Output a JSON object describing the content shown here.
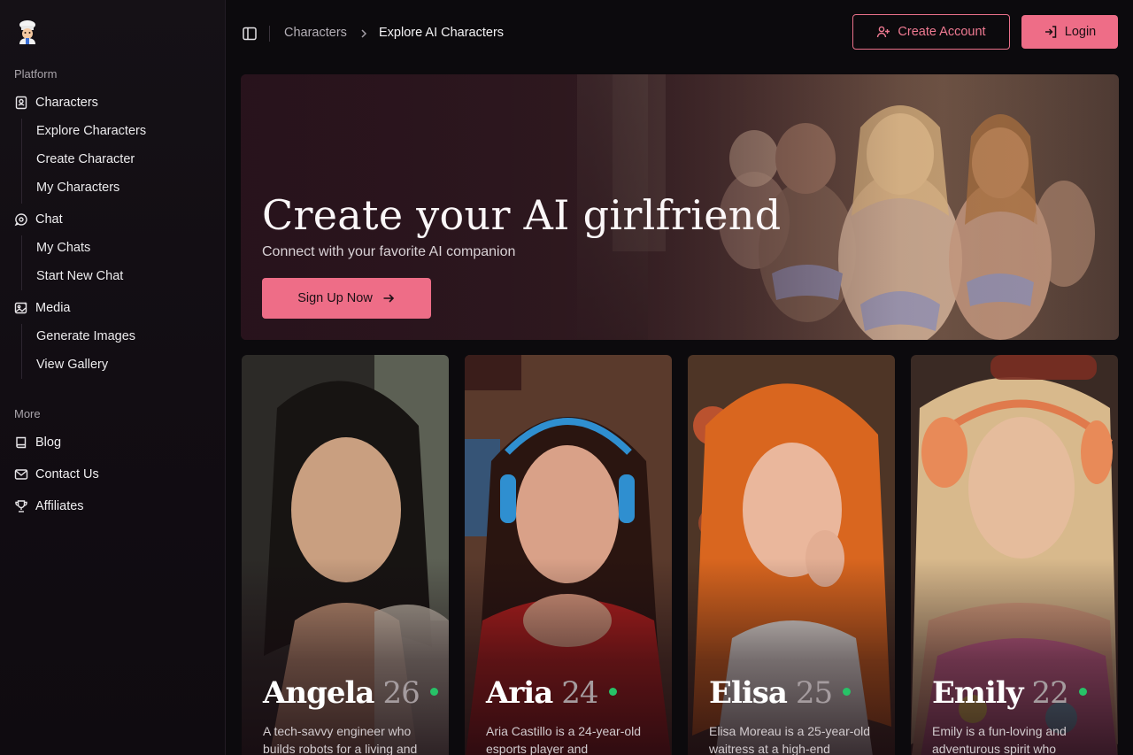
{
  "sidebar": {
    "platform_label": "Platform",
    "more_label": "More",
    "characters": {
      "label": "Characters",
      "items": [
        "Explore Characters",
        "Create Character",
        "My Characters"
      ]
    },
    "chat": {
      "label": "Chat",
      "items": [
        "My Chats",
        "Start New Chat"
      ]
    },
    "media": {
      "label": "Media",
      "items": [
        "Generate Images",
        "View Gallery"
      ]
    },
    "more": [
      "Blog",
      "Contact Us",
      "Affiliates"
    ]
  },
  "header": {
    "breadcrumb": [
      "Characters",
      "Explore AI Characters"
    ],
    "create_account": "Create Account",
    "login": "Login"
  },
  "hero": {
    "title": "Create your AI girlfriend",
    "subtitle": "Connect with your favorite AI companion",
    "cta": "Sign Up Now"
  },
  "cards": [
    {
      "name": "Angela",
      "age": "26",
      "desc": "A tech-savvy engineer who builds robots for a living and"
    },
    {
      "name": "Aria",
      "age": "24",
      "desc": "Aria Castillo is a 24-year-old esports player and"
    },
    {
      "name": "Elisa",
      "age": "25",
      "desc": "Elisa Moreau is a 25-year-old waitress at a high-end"
    },
    {
      "name": "Emily",
      "age": "22",
      "desc": "Emily is a fun-loving and adventurous spirit who"
    }
  ],
  "colors": {
    "accent": "#ee6d87",
    "online": "#27c267",
    "background": "#0c0a0d"
  }
}
